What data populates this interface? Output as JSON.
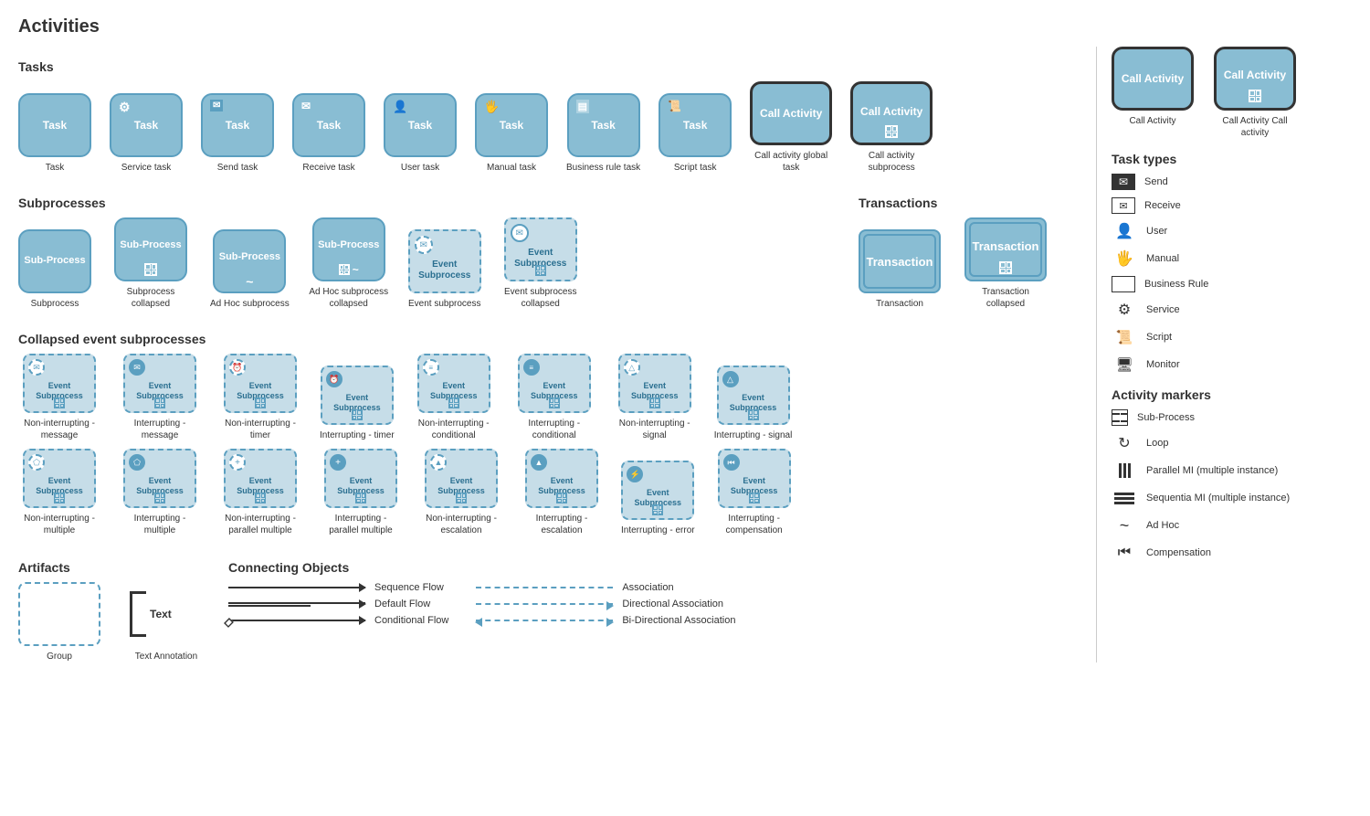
{
  "page": {
    "title": "Activities",
    "sections": {
      "tasks": {
        "label": "Tasks",
        "items": [
          {
            "id": "task",
            "label": "Task",
            "icon": "",
            "border": "solid"
          },
          {
            "id": "service-task",
            "label": "Service task",
            "icon": "⚙",
            "border": "solid"
          },
          {
            "id": "send-task",
            "label": "Send task",
            "icon": "✉",
            "border": "solid"
          },
          {
            "id": "receive-task",
            "label": "Receive task",
            "icon": "✉",
            "border": "solid"
          },
          {
            "id": "user-task",
            "label": "User task",
            "icon": "👤",
            "border": "solid"
          },
          {
            "id": "manual-task",
            "label": "Manual task",
            "icon": "🖐",
            "border": "solid"
          },
          {
            "id": "business-rule-task",
            "label": "Business rule task",
            "icon": "≡",
            "border": "solid"
          },
          {
            "id": "script-task",
            "label": "Script task",
            "icon": "≡",
            "border": "solid"
          },
          {
            "id": "call-activity-global",
            "label": "Call activity global task",
            "icon": "",
            "border": "thick"
          },
          {
            "id": "call-activity-subprocess",
            "label": "Call activity subprocess",
            "icon": "grid",
            "border": "thick"
          }
        ]
      },
      "subprocesses": {
        "label": "Subprocesses",
        "items": [
          {
            "id": "subprocess",
            "label": "Subprocess",
            "icon": "",
            "marker": "none"
          },
          {
            "id": "subprocess-collapsed",
            "label": "Subprocess collapsed",
            "icon": "",
            "marker": "grid"
          },
          {
            "id": "adhoc-subprocess",
            "label": "Ad Hoc subprocess",
            "icon": "",
            "marker": "tilde"
          },
          {
            "id": "adhoc-collapsed",
            "label": "Ad Hoc subprocess collapsed",
            "icon": "",
            "marker": "grid-tilde"
          },
          {
            "id": "event-subprocess",
            "label": "Event subprocess",
            "icon": "✉",
            "marker": "none",
            "dashed": true
          },
          {
            "id": "event-subprocess-collapsed",
            "label": "Event subprocess collapsed",
            "icon": "✉",
            "marker": "grid",
            "dashed": true
          }
        ]
      },
      "transactions": {
        "label": "Transactions",
        "items": [
          {
            "id": "transaction",
            "label": "Transaction"
          },
          {
            "id": "transaction-collapsed",
            "label": "Transaction collapsed"
          }
        ]
      },
      "collapsed_event": {
        "label": "Collapsed event subprocesses",
        "rows": [
          [
            {
              "id": "non-int-message",
              "label": "Non-interrupting - message",
              "icon": "✉",
              "circle_type": "dashed"
            },
            {
              "id": "int-message",
              "label": "Interrupting - message",
              "icon": "✉",
              "circle_type": "filled"
            },
            {
              "id": "non-int-timer",
              "label": "Non-interrupting - timer",
              "icon": "⏰",
              "circle_type": "dashed"
            },
            {
              "id": "int-timer",
              "label": "Interrupting - timer",
              "icon": "⏰",
              "circle_type": "filled"
            },
            {
              "id": "non-int-conditional",
              "label": "Non-interrupting - conditional",
              "icon": "≡",
              "circle_type": "dashed"
            },
            {
              "id": "int-conditional",
              "label": "Interrupting - conditional",
              "icon": "≡",
              "circle_type": "filled"
            },
            {
              "id": "non-int-signal",
              "label": "Non-interrupting - signal",
              "icon": "△",
              "circle_type": "dashed"
            },
            {
              "id": "int-signal",
              "label": "Interrupting - signal",
              "icon": "△",
              "circle_type": "filled"
            }
          ],
          [
            {
              "id": "non-int-multiple",
              "label": "Non-interrupting - multiple",
              "icon": "⬠",
              "circle_type": "dashed"
            },
            {
              "id": "int-multiple",
              "label": "Interrupting - multiple",
              "icon": "⬠",
              "circle_type": "filled"
            },
            {
              "id": "non-int-parallel",
              "label": "Non-interrupting - parallel multiple",
              "icon": "+",
              "circle_type": "dashed"
            },
            {
              "id": "int-parallel",
              "label": "Interrupting - parallel multiple",
              "icon": "+",
              "circle_type": "filled"
            },
            {
              "id": "non-int-escalation",
              "label": "Non-interrupting - escalation",
              "icon": "△",
              "circle_type": "dashed"
            },
            {
              "id": "int-escalation",
              "label": "Interrupting - escalation",
              "icon": "△",
              "circle_type": "filled"
            },
            {
              "id": "int-error",
              "label": "Interrupting - error",
              "icon": "⚡",
              "circle_type": "filled"
            },
            {
              "id": "int-compensation",
              "label": "Interrupting - compensation",
              "icon": "⏮",
              "circle_type": "filled"
            }
          ]
        ]
      },
      "artifacts": {
        "label": "Artifacts",
        "group_label": "Group",
        "annotation_label": "Text Annotation",
        "text": "Text"
      },
      "connecting_objects": {
        "label": "Connecting Objects",
        "items": [
          {
            "id": "sequence-flow",
            "label": "Sequence Flow",
            "type": "solid-arrow"
          },
          {
            "id": "default-flow",
            "label": "Default Flow",
            "type": "solid-double-arrow"
          },
          {
            "id": "conditional-flow",
            "label": "Conditional Flow",
            "type": "diamond-arrow"
          },
          {
            "id": "association",
            "label": "Association",
            "type": "dashed"
          },
          {
            "id": "directional-association",
            "label": "Directional Association",
            "type": "dashed-arrow"
          },
          {
            "id": "bidirectional-association",
            "label": "Bi-Directional Association",
            "type": "dashed-arrow-both"
          }
        ]
      }
    },
    "right_panel": {
      "task_types": {
        "label": "Task types",
        "items": [
          {
            "id": "send",
            "label": "Send",
            "icon": "envelope-filled"
          },
          {
            "id": "receive",
            "label": "Receive",
            "icon": "envelope-open"
          },
          {
            "id": "user",
            "label": "User",
            "icon": "user"
          },
          {
            "id": "manual",
            "label": "Manual",
            "icon": "hand"
          },
          {
            "id": "business-rule",
            "label": "Business Rule",
            "icon": "table"
          },
          {
            "id": "service",
            "label": "Service",
            "icon": "gear"
          },
          {
            "id": "script",
            "label": "Script",
            "icon": "scroll"
          },
          {
            "id": "monitor",
            "label": "Monitor",
            "icon": "monitor"
          }
        ]
      },
      "activity_markers": {
        "label": "Activity markers",
        "items": [
          {
            "id": "subprocess-marker",
            "label": "Sub-Process",
            "icon": "grid"
          },
          {
            "id": "loop-marker",
            "label": "Loop",
            "icon": "loop"
          },
          {
            "id": "parallel-mi",
            "label": "Parallel MI (multiple instance)",
            "icon": "parallel-lines"
          },
          {
            "id": "sequential-mi",
            "label": "Sequentia MI (multiple instance)",
            "icon": "sequential-lines"
          },
          {
            "id": "adhoc-marker",
            "label": "Ad Hoc",
            "icon": "tilde"
          },
          {
            "id": "compensation-marker",
            "label": "Compensation",
            "icon": "rewind"
          }
        ]
      }
    }
  }
}
